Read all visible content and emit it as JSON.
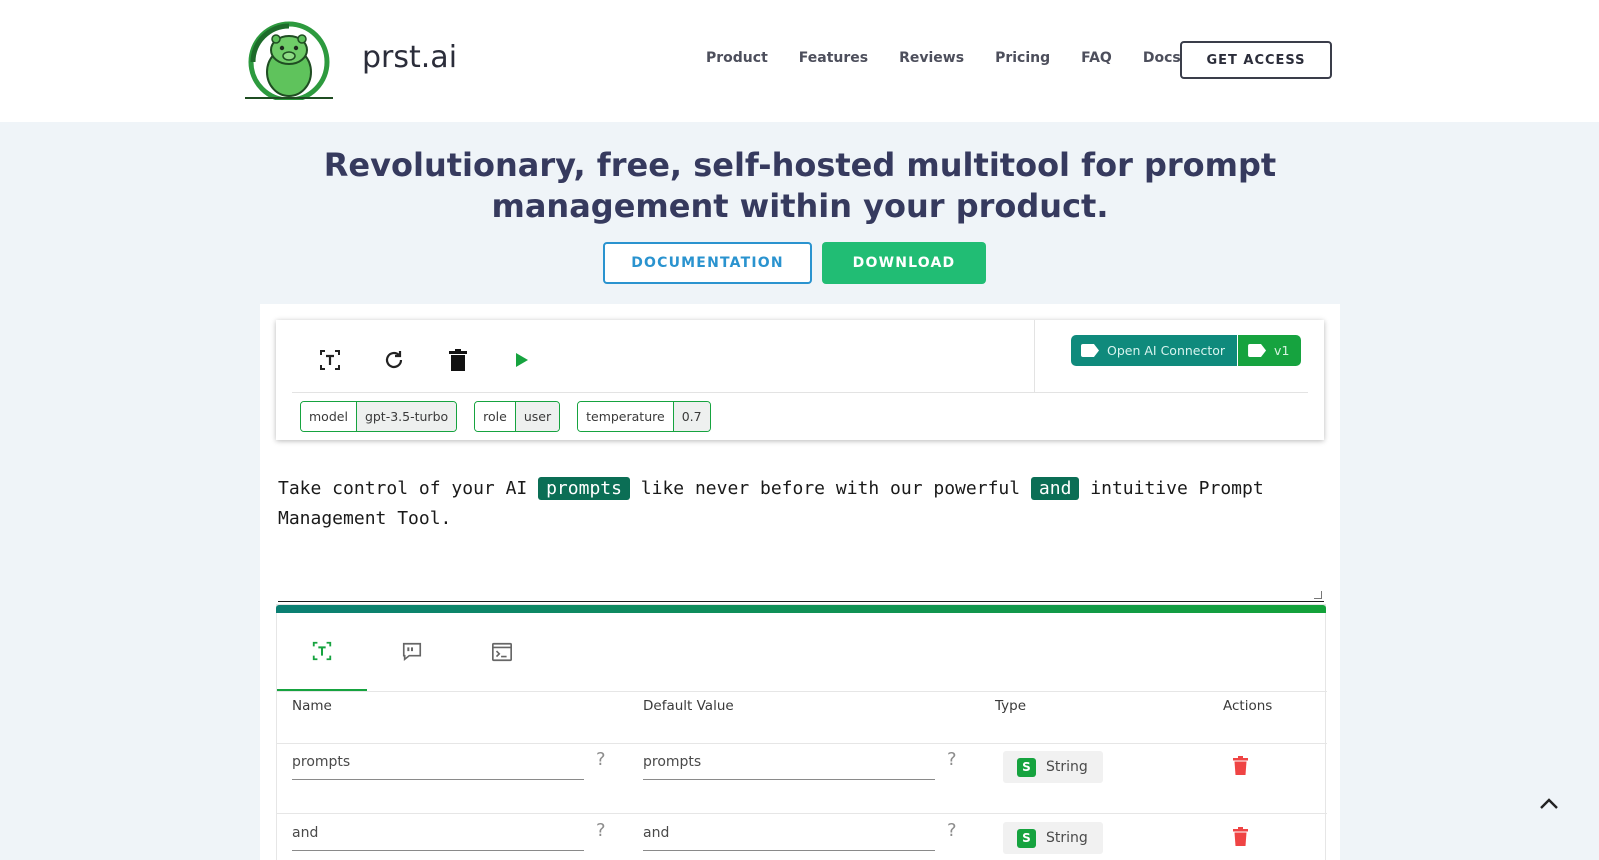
{
  "brand": {
    "name": "prst.ai"
  },
  "nav": {
    "items": [
      "Product",
      "Features",
      "Reviews",
      "Pricing",
      "FAQ",
      "Docs"
    ],
    "cta": "GET ACCESS"
  },
  "hero": {
    "title": "Revolutionary, free, self-hosted multitool for prompt management within your product.",
    "documentation_label": "DOCUMENTATION",
    "download_label": "DOWNLOAD"
  },
  "toolbar": {
    "icons": [
      "text-variable-icon",
      "refresh-icon",
      "trash-icon",
      "play-icon"
    ],
    "connector": {
      "name": "Open AI Connector",
      "version": "v1"
    },
    "chips": [
      {
        "key": "model",
        "value": "gpt-3.5-turbo"
      },
      {
        "key": "role",
        "value": "user"
      },
      {
        "key": "temperature",
        "value": "0.7"
      }
    ]
  },
  "editor": {
    "segments": [
      {
        "text": "Take control of your AI ",
        "highlight": false
      },
      {
        "text": "prompts",
        "highlight": true
      },
      {
        "text": " like never before with our powerful ",
        "highlight": false
      },
      {
        "text": "and",
        "highlight": true
      },
      {
        "text": " intuitive Prompt Management Tool.",
        "highlight": false
      }
    ]
  },
  "variables": {
    "tabs": [
      "text-variable-icon",
      "quote-bubble-icon",
      "terminal-icon"
    ],
    "active_tab": 0,
    "columns": [
      "Name",
      "Default Value",
      "Type",
      "Actions"
    ],
    "rows": [
      {
        "name": "prompts",
        "default": "prompts",
        "type": "String",
        "type_badge": "S"
      },
      {
        "name": "and",
        "default": "and",
        "type": "String",
        "type_badge": "S"
      }
    ],
    "help_mark": "?"
  },
  "colors": {
    "accent_green": "#16a33f",
    "teal": "#0f8a7c",
    "highlight": "#0b6e55",
    "doc_blue": "#2a93cf",
    "download_green": "#21bd74",
    "danger": "#ef4444"
  }
}
